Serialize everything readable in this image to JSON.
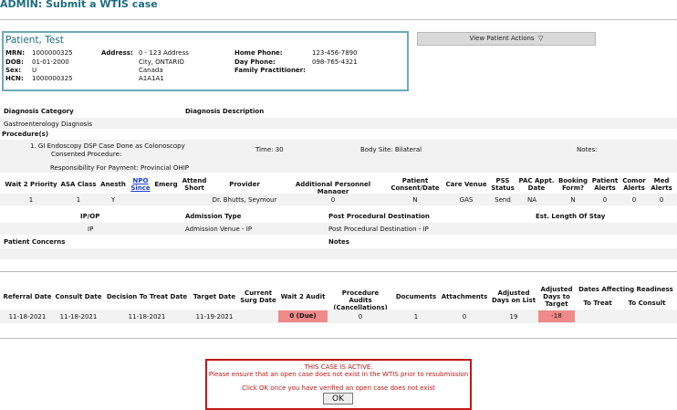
{
  "page": {
    "title": "ADMIN: Submit a WTIS case"
  },
  "patient": {
    "name": "Patient, Test",
    "mrn_label": "MRN:",
    "mrn": "1000000325",
    "dob_label": "DOB:",
    "dob": "01-01-2000",
    "sex_label": "Sex:",
    "sex": "U",
    "hcn_label": "HCN:",
    "hcn": "1000000325",
    "address_label": "Address:",
    "address": [
      "0 - 123 Address",
      "City, ONTARIO",
      "Canada",
      "A1A1A1"
    ],
    "home_phone_label": "Home Phone:",
    "home_phone": "123-456-7890",
    "day_phone_label": "Day Phone:",
    "day_phone": "098-765-4321",
    "family_practitioner_label": "Family Practitioner:",
    "family_practitioner": ""
  },
  "view_patient_actions": {
    "label": "View Patient Actions",
    "chevron": "▽"
  },
  "diagnosis": {
    "category_label": "Diagnosis Category",
    "description_label": "Diagnosis Description",
    "category": "Gastroenterology Diagnosis",
    "description": ""
  },
  "procedures": {
    "label": "Procedure(s)",
    "line1": "1. GI Endoscopy DSP Case Done as Colonoscopy",
    "line2": "Consented Procedure:",
    "time": "Time: 30",
    "body_site": "Body Site: Bilateral",
    "notes": "Notes:",
    "responsibility": "Responsibility For Payment: Provincial OHIP"
  },
  "case_table": {
    "headers": {
      "wait2": "Wait 2 Priority",
      "asa": "ASA Class",
      "anesth": "Anesth",
      "npo1": "NPO",
      "npo2": "Since",
      "emerg": "Emerg",
      "attend1": "Attend",
      "attend2": "Short",
      "provider": "Provider",
      "addl": "Additional Personnel Manager",
      "consent1": "Patient",
      "consent2": "Consent/Date",
      "venue": "Care Venue",
      "pss1": "PSS",
      "pss2": "Status",
      "pac1": "PAC Appt.",
      "pac2": "Date",
      "booking1": "Booking",
      "booking2": "Form?",
      "palerts1": "Patient",
      "palerts2": "Alerts",
      "comor1": "Comor",
      "comor2": "Alerts",
      "med1": "Med",
      "med2": "Alerts"
    },
    "row": {
      "wait2": "1",
      "asa": "1",
      "anesth": "Y",
      "npo": "",
      "emerg": "",
      "attend": "",
      "provider": "Dr. Bhutts, Seymour",
      "addl": "0",
      "consent": "N",
      "venue": "GAS",
      "pss": "Send",
      "pac": "NA",
      "booking": "N",
      "palerts": "0",
      "comor": "0",
      "med": "0"
    }
  },
  "admission": {
    "ipop_label": "IP/OP",
    "type_label": "Admission Type",
    "ppd_label": "Post Procedural Destination",
    "los_label": "Est. Length Of Stay",
    "ipop": "IP",
    "type": "Admission Venue - IP",
    "ppd": "Post Procedural Destination - IP",
    "los": ""
  },
  "concerns": {
    "label": "Patient Concerns",
    "notes_label": "Notes",
    "value": "",
    "notes": ""
  },
  "referral_table": {
    "headers": {
      "referral": "Referral Date",
      "consult": "Consult Date",
      "dtt": "Decision To Treat Date",
      "target": "Target Date",
      "surg1": "Current",
      "surg2": "Surg Date",
      "audit": "Wait 2 Audit",
      "pa1": "Procedure Audits",
      "pa2": "(Cancellations)",
      "docs": "Documents",
      "attach": "Attachments",
      "adj1": "Adjusted",
      "adj2": "Days on List",
      "adjt1": "Adjusted",
      "adjt2": "Days to",
      "adjt3": "Target",
      "dates_aff": "Dates Affecting Readiness",
      "to_treat": "To Treat",
      "to_consult": "To Consult"
    },
    "row": {
      "referral": "11-18-2021",
      "consult": "11-18-2021",
      "dtt": "11-18-2021",
      "target": "11-19-2021",
      "surg": "",
      "audit": "0 (Due)",
      "pa": "0",
      "docs": "1",
      "attach": "0",
      "adj_list": "19",
      "adj_target": "-18",
      "to_treat": "",
      "to_consult": ""
    }
  },
  "alert": {
    "line1": "THIS CASE IS ACTIVE.",
    "line2": "Please ensure that an open case does not exist in the WTIS prior to resubmission",
    "line3": "Click OK once you have verified an open case does not exist",
    "ok_label": "OK"
  },
  "colors": {
    "title": "#1d6e80",
    "box_border": "#6ea9b7",
    "alert": "#c01616",
    "highlight": "#f08a8a",
    "link": "#1e3ec9"
  }
}
